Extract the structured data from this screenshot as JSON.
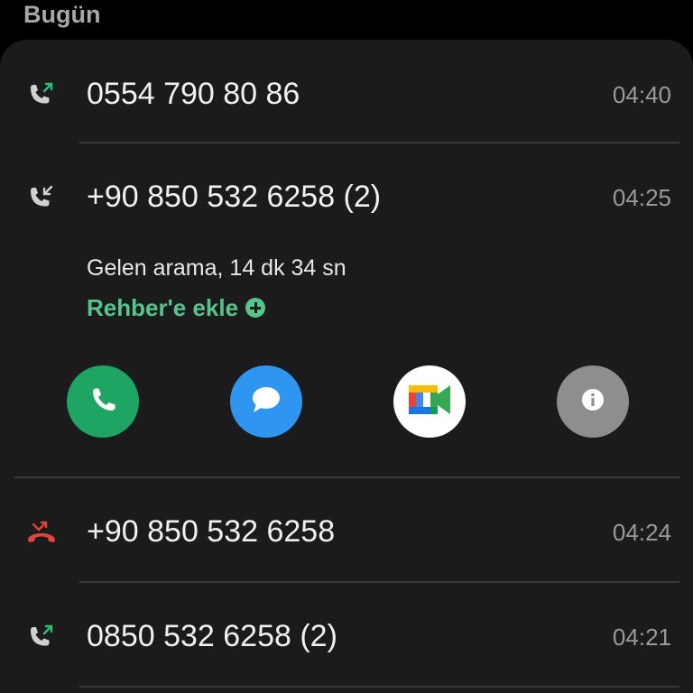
{
  "section_header": "Bugün",
  "colors": {
    "outgoing": "#2fbf71",
    "incoming": "#d0d0d0",
    "missed": "#e0443a",
    "link": "#56c48c"
  },
  "calls": [
    {
      "number": "0554 790 80 86",
      "time": "04:40",
      "type": "outgoing",
      "icon": "outgoing-call-icon"
    },
    {
      "number": "+90 850 532 6258 (2)",
      "time": "04:25",
      "type": "incoming",
      "icon": "incoming-call-icon"
    },
    {
      "number": "+90 850 532 6258",
      "time": "04:24",
      "type": "missed",
      "icon": "missed-call-icon"
    },
    {
      "number": "0850 532 6258 (2)",
      "time": "04:21",
      "type": "outgoing",
      "icon": "outgoing-call-icon"
    }
  ],
  "expanded": {
    "detail": "Gelen arama, 14 dk 34 sn",
    "add_contact_label": "Rehber'e ekle",
    "actions": [
      {
        "icon": "phone-icon"
      },
      {
        "icon": "message-icon"
      },
      {
        "icon": "google-meet-icon"
      },
      {
        "icon": "info-icon"
      }
    ]
  }
}
